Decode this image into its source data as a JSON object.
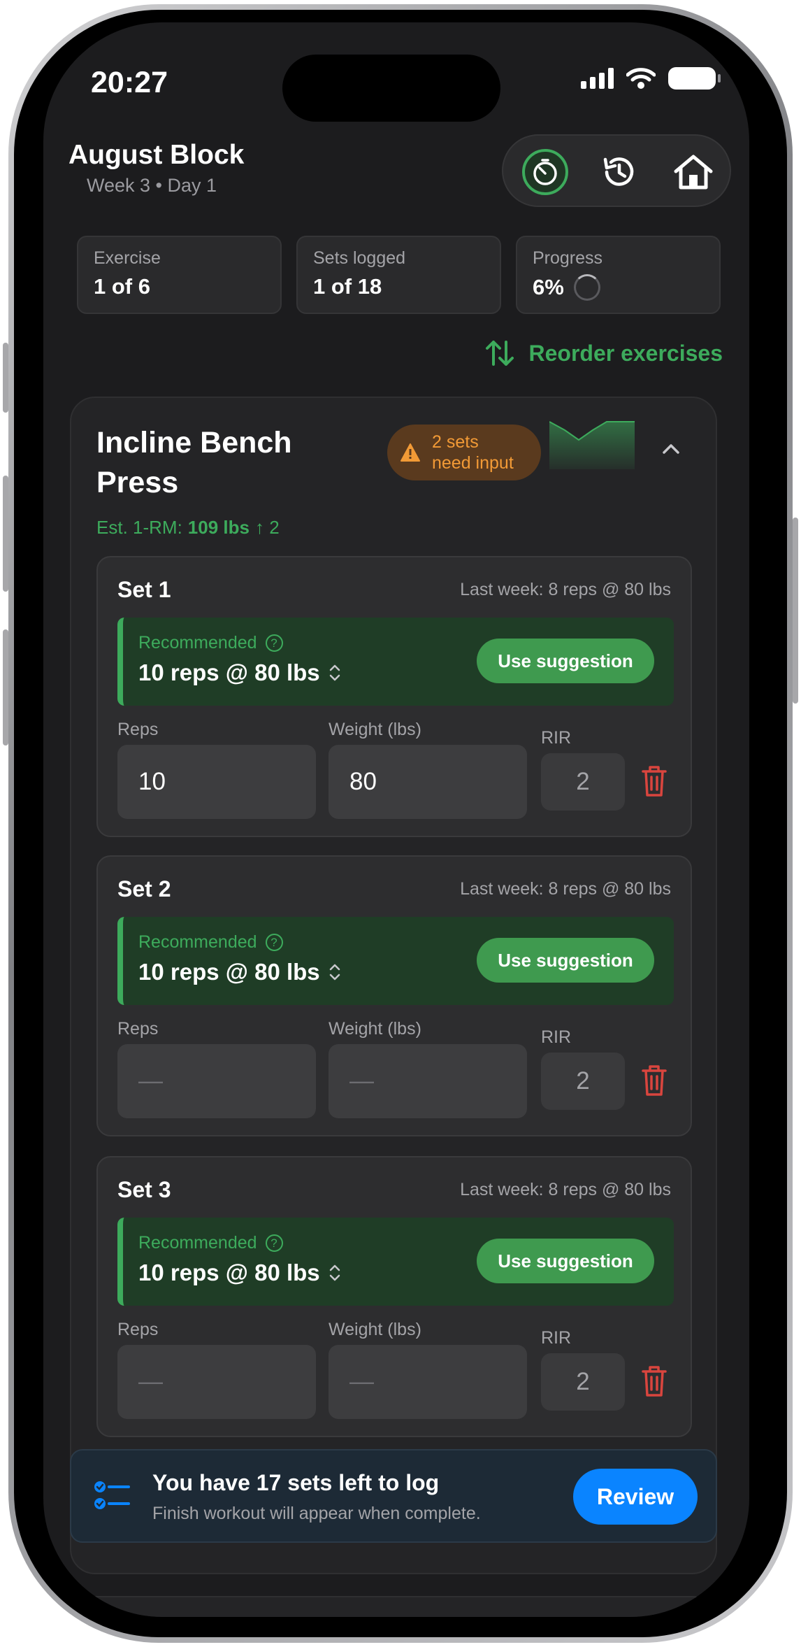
{
  "status": {
    "time": "20:27"
  },
  "header": {
    "title": "August Block",
    "subtitle": "Week 3 • Day 1"
  },
  "stats": [
    {
      "label": "Exercise",
      "value": "1 of 6"
    },
    {
      "label": "Sets logged",
      "value": "1 of 18"
    },
    {
      "label": "Progress",
      "value": "6%"
    }
  ],
  "reorder_label": "Reorder exercises",
  "exercise": {
    "name": "Incline Bench Press",
    "warning": {
      "line1": "2 sets",
      "line2": "need input"
    },
    "one_rm": {
      "label": "Est. 1-RM:",
      "value": "109 lbs",
      "delta": "↑ 2"
    },
    "sets": [
      {
        "title": "Set 1",
        "last_week": "Last week: 8 reps @ 80 lbs",
        "rec_label": "Recommended",
        "rec_value": "10 reps @ 80 lbs",
        "use_label": "Use suggestion",
        "reps_label": "Reps",
        "weight_label": "Weight (lbs)",
        "reps": "10",
        "weight": "80",
        "rir_label": "RIR",
        "rir": "2"
      },
      {
        "title": "Set 2",
        "last_week": "Last week: 8 reps @ 80 lbs",
        "rec_label": "Recommended",
        "rec_value": "10 reps @ 80 lbs",
        "use_label": "Use suggestion",
        "reps_label": "Reps",
        "weight_label": "Weight (lbs)",
        "reps": "—",
        "weight": "—",
        "rir_label": "RIR",
        "rir": "2"
      },
      {
        "title": "Set 3",
        "last_week": "Last week: 8 reps @ 80 lbs",
        "rec_label": "Recommended",
        "rec_value": "10 reps @ 80 lbs",
        "use_label": "Use suggestion",
        "reps_label": "Reps",
        "weight_label": "Weight (lbs)",
        "reps": "—",
        "weight": "—",
        "rir_label": "RIR",
        "rir": "2"
      }
    ]
  },
  "banner": {
    "title": "You have 17 sets left to log",
    "subtitle": "Finish workout will appear when complete.",
    "button": "Review"
  },
  "colors": {
    "accent_green": "#3dab5c",
    "warning_orange": "#f29a36",
    "review_blue": "#0a84ff",
    "delete_red": "#d9453e"
  }
}
